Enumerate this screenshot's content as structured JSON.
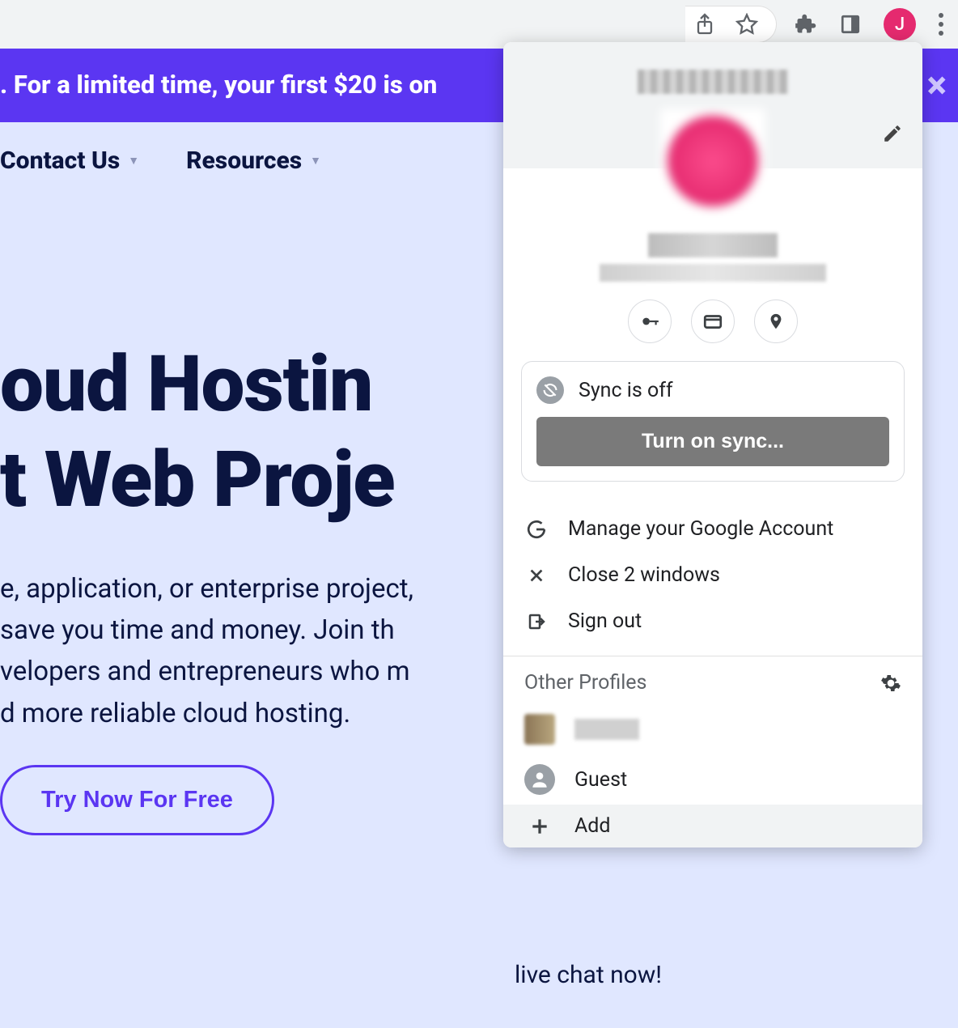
{
  "chrome": {
    "avatar_letter": "J"
  },
  "page": {
    "promo": ". For a limited time, your first $20 is on",
    "nav": {
      "contact": "Contact Us",
      "resources": "Resources"
    },
    "hero_title_line1": "oud Hostin",
    "hero_title_line2": "t Web Proje",
    "hero_body_line1": "e, application, or enterprise project,",
    "hero_body_line2": " save you time and money. Join th",
    "hero_body_line3": "velopers and entrepreneurs who m",
    "hero_body_line4": "d more reliable cloud hosting.",
    "cta": "Try Now For Free",
    "chat_snippet": "live chat now!"
  },
  "popup": {
    "sync_status": "Sync is off",
    "sync_button": "Turn on sync...",
    "menu": {
      "manage_account": "Manage your Google Account",
      "close_windows": "Close 2 windows",
      "sign_out": "Sign out"
    },
    "other_profiles_heading": "Other Profiles",
    "guest": "Guest",
    "add": "Add"
  }
}
